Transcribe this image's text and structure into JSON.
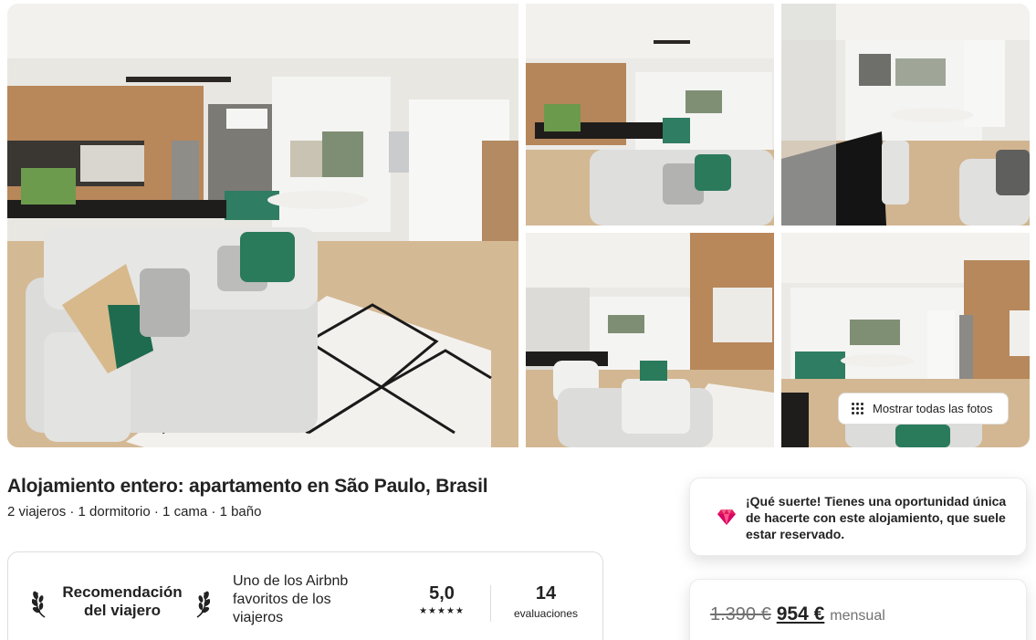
{
  "gallery": {
    "show_all_label": "Mostrar todas las fotos"
  },
  "listing": {
    "title": "Alojamiento entero: apartamento en São Paulo, Brasil",
    "details": "2 viajeros · 1 dormitorio · 1 cama · 1 baño"
  },
  "guest_favorite": {
    "badge_line1": "Recomendación",
    "badge_line2": "del viajero",
    "description": "Uno de los Airbnb favoritos de los viajeros",
    "rating": "5,0",
    "stars": "★★★★★",
    "reviews_count": "14",
    "reviews_label": "evaluaciones"
  },
  "rare_find": {
    "icon": "gem-icon",
    "text": "¡Qué suerte! Tienes una oportunidad única de hacerte con este alojamiento, que suele estar reservado."
  },
  "price": {
    "original": "1.390 €",
    "discounted": "954 €",
    "period": "mensual"
  },
  "colors": {
    "text": "#222222",
    "secondary_text": "#717171",
    "border": "#dddddd",
    "gem": "#e31c5f"
  }
}
